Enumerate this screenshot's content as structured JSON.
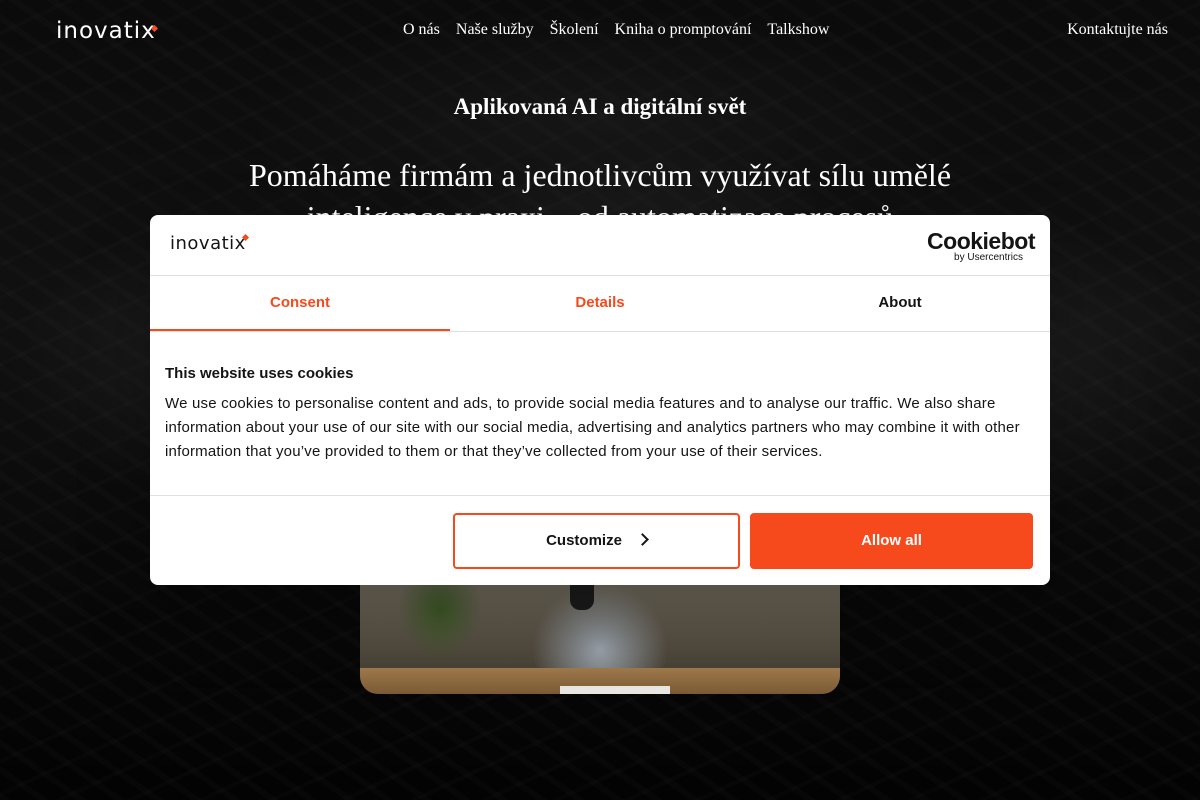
{
  "header": {
    "logo_text": "inovati",
    "logo_last": "x",
    "nav": [
      "O nás",
      "Naše služby",
      "Školení",
      "Kniha o promptování",
      "Talkshow"
    ],
    "contact": "Kontaktujte nás"
  },
  "hero": {
    "kicker": "Aplikovaná AI a digitální svět",
    "headline": "Pomáháme firmám a jednotlivcům využívat sílu umělé inteligence v praxi – od automatizace procesů"
  },
  "cookie_dialog": {
    "logo_text": "inovatix",
    "cookiebot_name": "Cookiebot",
    "cookiebot_sub": "by Usercentrics",
    "tabs": [
      "Consent",
      "Details",
      "About"
    ],
    "heading": "This website uses cookies",
    "body": "We use cookies to personalise content and ads, to provide social media features and to analyse our traffic. We also share information about your use of our site with our social media, advertising and analytics partners who may combine it with other information that you’ve provided to them or that they’ve collected from your use of their services.",
    "customize_label": "Customize",
    "allow_label": "Allow all"
  },
  "colors": {
    "accent": "#f64a1c",
    "text_dark": "#141414",
    "dialog_bg": "#ffffff"
  },
  "icons": {
    "customize_chevron": "chevron-right-icon",
    "logo_mark": "diamond-mark-icon"
  }
}
